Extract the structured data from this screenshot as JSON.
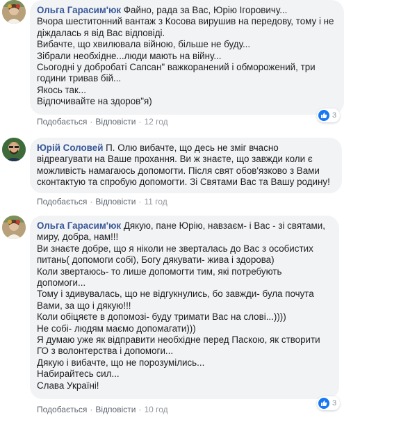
{
  "comments": [
    {
      "author": "Ольга Гарасим'юк",
      "lines": [
        "Файно, рада за Вас, Юрію Ігоровичу...",
        "Вчора шеститонний вантаж з Косова вирушив на передову, тому і не",
        "діждалась я від Вас відповіді.",
        "Вибачте, що хвилювала війною, більше не буду...",
        "Зібрали необхідне...люди мають на війну...",
        "Сьогодні у добробаті Сапсан\" важкоранений і обморожений, три",
        "години тривав бій...",
        "Якось так...",
        "Відпочивайте на здоров\"я)"
      ],
      "like": "Подобається",
      "reply": "Відповісти",
      "time": "12 год",
      "reactions": "3"
    },
    {
      "author": "Юрій Соловей",
      "lines": [
        "П. Олю вибачте, що десь не зміг вчасно",
        "відреагувати на Ваше прохання. Ви ж знаєте, що завжди коли є",
        "можливість намагаюсь допомогти. Після свят обов'язково з Вами",
        "сконтактую та спробую допомогти. Зі Святами Вас та Вашу родину!"
      ],
      "like": "Подобається",
      "reply": "Відповісти",
      "time": "11 год"
    },
    {
      "author": "Ольга Гарасим'юк",
      "lines": [
        "Дякую, пане Юрію, навзаєм- і Вас - зі святами,",
        "миру, добра, нам!!!",
        "Ви знаєте добре, що я ніколи не зверталась до Вас з особистих",
        "питань( допомоги собі), Богу дякувати- жива і здорова)",
        "Коли звертаюсь- то лише допомогти тим, які потребують",
        "допомоги...",
        "Тому і здивувалась, що не відгукнулись, бо завжди- була почута",
        "Вами, за що і дякую!!!",
        "Коли обіцяєте в допомозі- буду тримати Вас на слові...))))",
        "Не собі- людям маємо допомагати)))",
        "Я думаю уже як відправити необхідне перед Паскою, як створити",
        "ГО з волонтерства і допомоги...",
        "Дякую і вибачте, що не порозумілись...",
        "Набирайтесь сил...",
        "Слава Україні!"
      ],
      "like": "Подобається",
      "reply": "Відповісти",
      "time": "10 год",
      "reactions": "3"
    }
  ],
  "colors": {
    "author": "#385898",
    "bubble": "#f2f3f5",
    "like_badge": "#1877f2",
    "meta": "#90949c"
  },
  "icons": {
    "reaction": "thumbs-up-icon"
  }
}
